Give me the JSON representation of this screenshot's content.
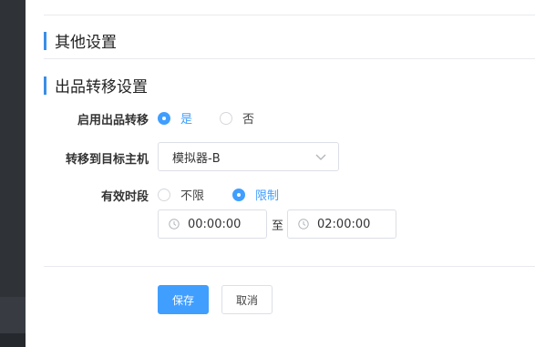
{
  "sections": {
    "other": {
      "title": "其他设置"
    },
    "transfer": {
      "title": "出品转移设置"
    }
  },
  "form": {
    "enable": {
      "label": "启用出品转移",
      "options": [
        {
          "label": "是",
          "checked": true
        },
        {
          "label": "否",
          "checked": false
        }
      ]
    },
    "target": {
      "label": "转移到目标主机",
      "value": "模拟器-B",
      "icon": "chevron-down-icon"
    },
    "period": {
      "label": "有效时段",
      "options": [
        {
          "label": "不限",
          "checked": false
        },
        {
          "label": "限制",
          "checked": true
        }
      ],
      "start": "00:00:00",
      "separator": "至",
      "end": "02:00:00",
      "icon": "clock-icon"
    }
  },
  "actions": {
    "save": "保存",
    "cancel": "取消"
  },
  "colors": {
    "accent": "#409eff",
    "section_bar": "#3a8ee6",
    "sidebar": "#2f3338"
  }
}
